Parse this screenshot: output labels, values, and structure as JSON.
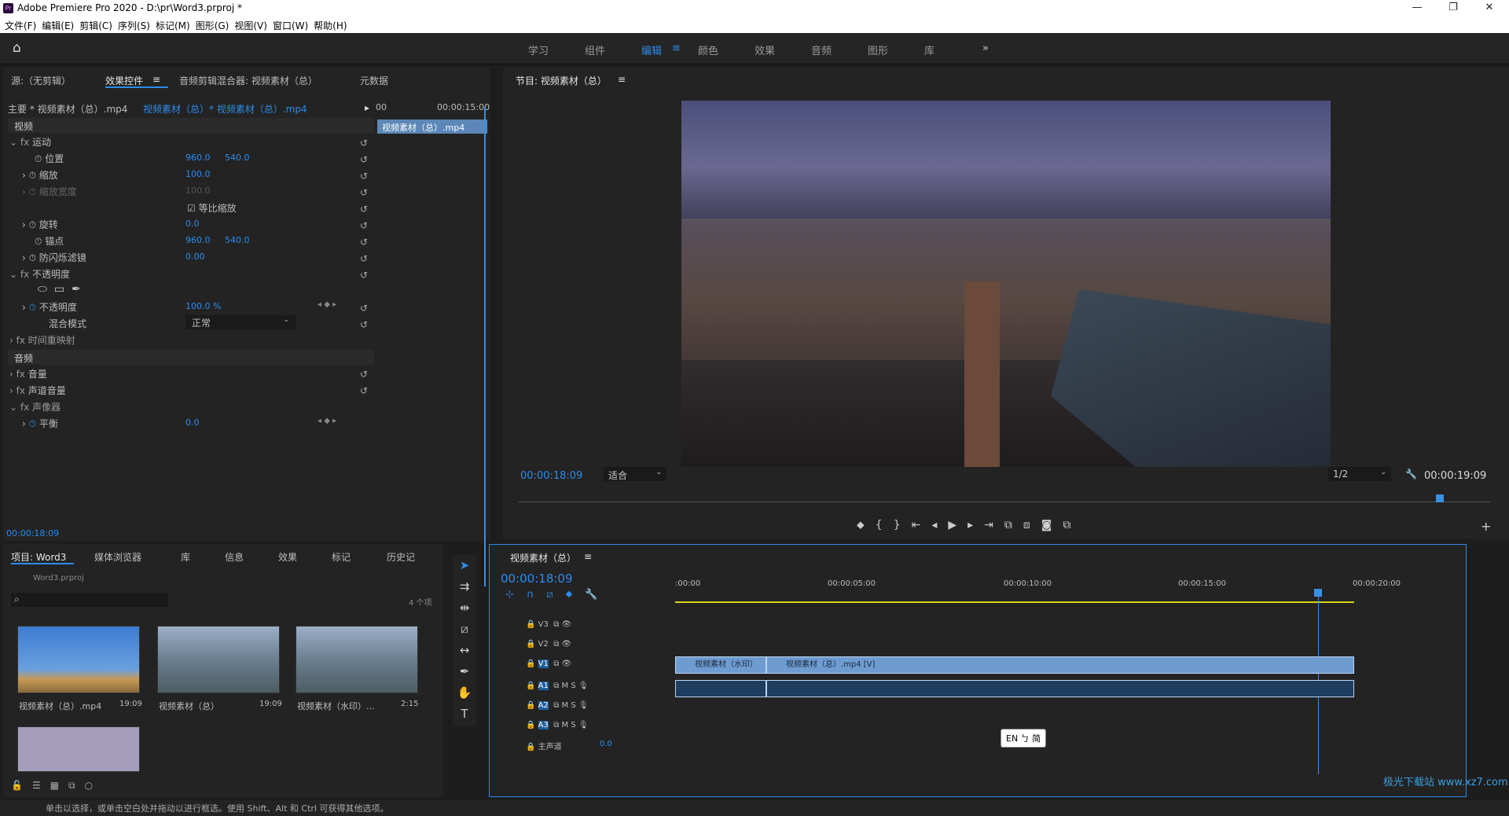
{
  "window": {
    "title": "Adobe Premiere Pro 2020 - D:\\pr\\Word3.prproj *",
    "logo": "Pr"
  },
  "menu": [
    "文件(F)",
    "编辑(E)",
    "剪辑(C)",
    "序列(S)",
    "标记(M)",
    "图形(G)",
    "视图(V)",
    "窗口(W)",
    "帮助(H)"
  ],
  "workspaces": [
    "学习",
    "组件",
    "编辑",
    "颜色",
    "效果",
    "音频",
    "图形",
    "库"
  ],
  "active_workspace": "编辑",
  "effect_panel": {
    "tabs": [
      "源:（无剪辑）",
      "效果控件",
      "音频剪辑混合器: 视频素材（总）",
      "元数据"
    ],
    "master": "主要 * 视频素材（总）.mp4",
    "seq": "视频素材（总）* 视频素材（总）.mp4",
    "tc_right": "00:00:15:00",
    "mini_clip": "视频素材（总）.mp4",
    "tc_small": "00",
    "video_header": "视频",
    "audio_header": "音频",
    "motion": "运动",
    "position": "位置",
    "pos_x": "960.0",
    "pos_y": "540.0",
    "scale": "缩放",
    "scale_v": "100.0",
    "scale_w": "缩放宽度",
    "scale_w_v": "100.0",
    "uniform": "等比缩放",
    "rotation": "旋转",
    "rot_v": "0.0",
    "anchor": "锚点",
    "anc_x": "960.0",
    "anc_y": "540.0",
    "flicker": "防闪烁滤镜",
    "flicker_v": "0.00",
    "opacity_fx": "不透明度",
    "opacity": "不透明度",
    "opacity_v": "100.0 %",
    "blend": "混合模式",
    "blend_v": "正常",
    "remap": "时间重映射",
    "volume": "音量",
    "channel_vol": "声道音量",
    "panner": "声像器",
    "balance": "平衡",
    "balance_v": "0.0",
    "tc_bottom": "00:00:18:09"
  },
  "program": {
    "title": "节目: 视频素材（总）",
    "tc_left": "00:00:18:09",
    "fit": "适合",
    "res": "1/2",
    "tc_right": "00:00:19:09"
  },
  "project": {
    "tabs": [
      "项目: Word3",
      "媒体浏览器",
      "库",
      "信息",
      "效果",
      "标记",
      "历史记"
    ],
    "file": "Word3.prproj",
    "count": "4 个项",
    "items": [
      {
        "name": "视频素材（总）.mp4",
        "dur": "19:09"
      },
      {
        "name": "视频素材（总）",
        "dur": "19:09"
      },
      {
        "name": "视频素材（水印）...",
        "dur": "2:15"
      }
    ]
  },
  "timeline": {
    "title": "视频素材（总）",
    "tc": "00:00:18:09",
    "ruler": [
      ":00:00",
      "00:00:05:00",
      "00:00:10:00",
      "00:00:15:00",
      "00:00:20:00"
    ],
    "tracks_v": [
      "V3",
      "V2",
      "V1"
    ],
    "tracks_a": [
      "A1",
      "A2",
      "A3"
    ],
    "master": "主声道",
    "master_v": "0.0",
    "clip1": "视频素材（水印）",
    "clip2": "视频素材（总）.mp4 [V]",
    "ime": "EN ㄅ 简"
  },
  "status": "单击以选择，或单击空白处并拖动以进行框选。使用 Shift、Alt 和 Ctrl 可获得其他选项。",
  "watermark": "极光下载站 www.xz7.com",
  "colors": {
    "accent": "#2d8ceb",
    "clip": "#6e9bd0",
    "playhead": "#3a8fe0"
  }
}
